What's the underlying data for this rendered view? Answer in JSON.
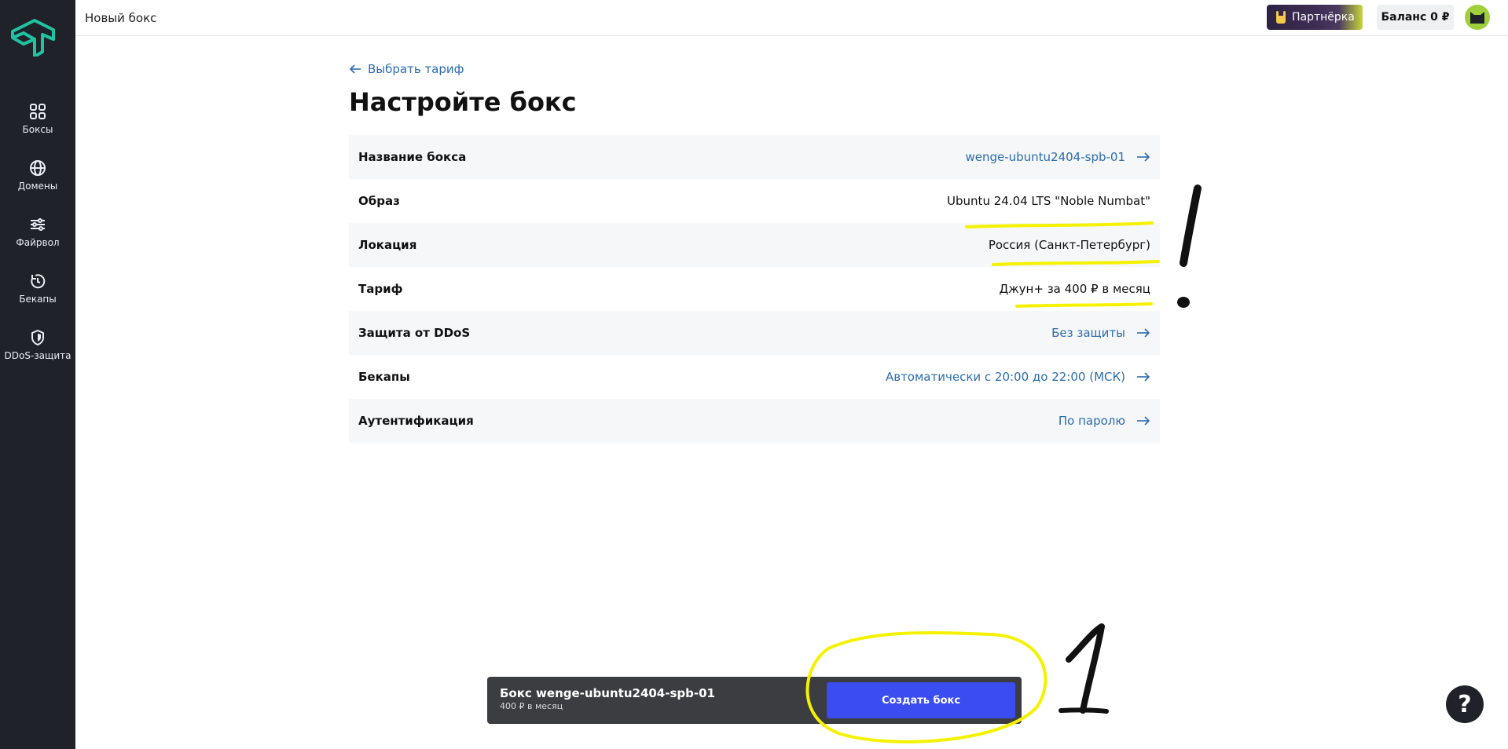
{
  "sidebar": {
    "items": [
      {
        "label": "Боксы",
        "icon": "grid-icon"
      },
      {
        "label": "Домены",
        "icon": "globe-icon"
      },
      {
        "label": "Файрвол",
        "icon": "sliders-icon"
      },
      {
        "label": "Бекапы",
        "icon": "backup-clock-icon"
      },
      {
        "label": "DDoS-защита",
        "icon": "shield-icon"
      }
    ]
  },
  "topbar": {
    "page_title": "Новый бокс",
    "partner_label": "Партнёрка",
    "balance_label": "Баланс 0 ₽"
  },
  "main": {
    "back_link": "Выбрать тариф",
    "title": "Настройте бокс",
    "rows": [
      {
        "label": "Название бокса",
        "value": "wenge-ubuntu2404-spb-01"
      },
      {
        "label": "Образ",
        "value": "Ubuntu 24.04 LTS \"Noble Numbat\""
      },
      {
        "label": "Локация",
        "value": "Россия (Санкт-Петербург)"
      },
      {
        "label": "Тариф",
        "value": "Джун+ за 400 ₽ в месяц"
      },
      {
        "label": "Защита от DDoS",
        "value": "Без защиты"
      },
      {
        "label": "Бекапы",
        "value": "Автоматически с 20:00 до 22:00 (МСК)"
      },
      {
        "label": "Аутентификация",
        "value": "По паролю"
      }
    ]
  },
  "bottom_bar": {
    "title": "Бокс wenge-ubuntu2404-spb-01",
    "price": "400 ₽ в месяц",
    "create_label": "Создать бокс"
  },
  "help": {
    "label": "?"
  },
  "colors": {
    "sidebar_bg": "#1f2329",
    "accent_teal": "#1fc4a3",
    "link_blue": "#2b6cb0",
    "button_blue": "#3b4df0",
    "highlight_yellow": "#f5f200"
  }
}
